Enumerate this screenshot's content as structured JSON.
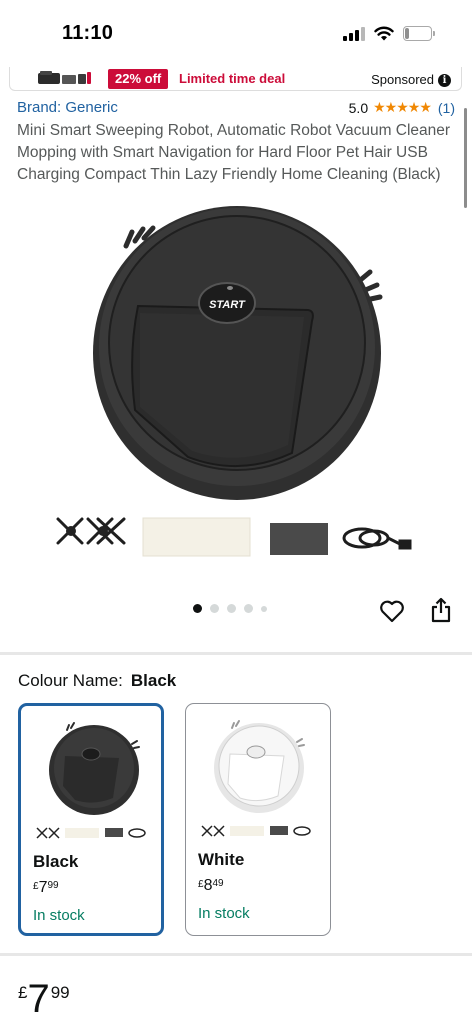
{
  "status_bar": {
    "time": "11:10",
    "battery_level": "4",
    "icons": [
      "cellular-signal-icon",
      "wifi-icon",
      "battery-icon"
    ]
  },
  "ad": {
    "badge": "22% off",
    "deal_text": "Limited time deal",
    "sponsored_label": "Sponsored",
    "info_glyph": "i"
  },
  "product": {
    "brand": "Brand: Generic",
    "rating_value": "5.0",
    "stars": "★★★★★",
    "rating_count": "(1)",
    "title": "Mini Smart Sweeping Robot, Automatic Robot Vacuum Cleaner Mopping with Smart Navigation for Hard Floor Pet Hair USB Charging Compact Thin Lazy Friendly Home Cleaning (Black)",
    "image_button_text": "START"
  },
  "carousel": {
    "dot_count": 5,
    "active_index": 0
  },
  "colour": {
    "label": "Colour Name:",
    "selected": "Black",
    "options": [
      {
        "name": "Black",
        "currency": "£",
        "whole": "7",
        "fraction": "99",
        "stock": "In stock"
      },
      {
        "name": "White",
        "currency": "£",
        "whole": "8",
        "fraction": "49",
        "stock": "In stock"
      }
    ]
  },
  "price": {
    "currency": "£",
    "whole": "7",
    "fraction": "99"
  },
  "colors": {
    "link": "#2162a1",
    "deal_red": "#cc0c39",
    "star": "#f08804",
    "in_stock": "#067d62",
    "selected_border": "#2162a1"
  }
}
